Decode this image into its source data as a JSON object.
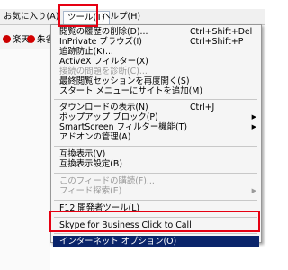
{
  "menubar": {
    "favorites": "お気に入り(A)",
    "tools": "ツール(T)",
    "help": "ヘルプ(H)"
  },
  "favbar": [
    {
      "label": "楽天",
      "color": "#cc0000"
    },
    {
      "label": "朱省",
      "color": "#d40000"
    }
  ],
  "menu": {
    "items": [
      {
        "label": "閲覧の履歴の削除(D)...",
        "shortcut": "Ctrl+Shift+Del",
        "disabled": false
      },
      {
        "label": "InPrivate ブラウズ(I)",
        "shortcut": "Ctrl+Shift+P",
        "disabled": false
      },
      {
        "label": "追跡防止(K)...",
        "disabled": false
      },
      {
        "label": "ActiveX フィルター(X)",
        "disabled": false
      },
      {
        "label": "接続の問題を診断(C)...",
        "disabled": true
      },
      {
        "label": "最終閲覧セッションを再度開く(S)",
        "disabled": false
      },
      {
        "label": "スタート メニューにサイトを追加(M)",
        "disabled": false
      },
      {
        "label": "ダウンロードの表示(N)",
        "shortcut": "Ctrl+J",
        "disabled": false
      },
      {
        "label": "ポップアップ ブロック(P)",
        "submenu": true,
        "disabled": false
      },
      {
        "label": "SmartScreen フィルター機能(T)",
        "submenu": true,
        "disabled": false
      },
      {
        "label": "アドオンの管理(A)",
        "disabled": false
      },
      {
        "label": "互換表示(V)",
        "disabled": false
      },
      {
        "label": "互換表示設定(B)",
        "disabled": false
      },
      {
        "label": "このフィードの購読(F)...",
        "disabled": true
      },
      {
        "label": "フィード探索(E)",
        "submenu": true,
        "disabled": true
      },
      {
        "label": "F12 開発者ツール(L)",
        "disabled": false
      },
      {
        "label": "Skype for Business Click to Call",
        "disabled": false
      },
      {
        "label": "インターネット オプション(O)",
        "selected": true
      }
    ],
    "submenu_arrow": "▶"
  },
  "colors": {
    "highlight_box": "#e60012",
    "selection": "#0a246a"
  }
}
